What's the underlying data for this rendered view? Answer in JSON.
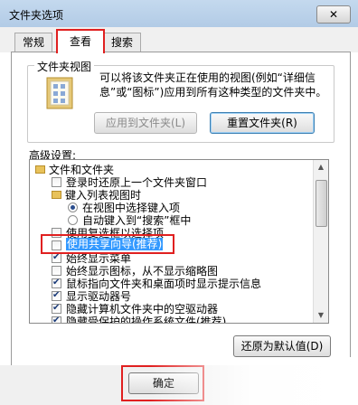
{
  "window": {
    "title": "文件夹选项",
    "close_label": "✕"
  },
  "tabs": [
    {
      "label": "常规"
    },
    {
      "label": "查看"
    },
    {
      "label": "搜索"
    }
  ],
  "folder_views": {
    "group_title": "文件夹视图",
    "description": "可以将该文件夹正在使用的视图(例如“详细信息”或“图标”)应用到所有这种类型的文件夹中。",
    "apply_button": "应用到文件夹(L)",
    "reset_button": "重置文件夹(R)"
  },
  "advanced": {
    "label": "高级设置:",
    "items": [
      {
        "text": "文件和文件夹",
        "kind": "folder"
      },
      {
        "text": "登录时还原上一个文件夹窗口",
        "kind": "checkbox",
        "checked": false
      },
      {
        "text": "键入列表视图时",
        "kind": "folder"
      },
      {
        "text": "在视图中选择键入项",
        "kind": "radio",
        "checked": true
      },
      {
        "text": "自动键入到“搜索”框中",
        "kind": "radio",
        "checked": false
      },
      {
        "text": "使用复选框以选择项",
        "kind": "checkbox",
        "checked": false
      },
      {
        "text": "使用共享向导(推荐)",
        "kind": "checkbox",
        "checked": false,
        "highlighted": true
      },
      {
        "text": "始终显示菜单",
        "kind": "checkbox",
        "checked": true
      },
      {
        "text": "始终显示图标，从不显示缩略图",
        "kind": "checkbox",
        "checked": false
      },
      {
        "text": "鼠标指向文件夹和桌面项时显示提示信息",
        "kind": "checkbox",
        "checked": true
      },
      {
        "text": "显示驱动器号",
        "kind": "checkbox",
        "checked": true
      },
      {
        "text": "隐藏计算机文件夹中的空驱动器",
        "kind": "checkbox",
        "checked": true
      },
      {
        "text": "隐藏受保护的操作系统文件(推荐)",
        "kind": "checkbox",
        "checked": true
      }
    ],
    "restore_button": "还原为默认值(D)"
  },
  "footer": {
    "ok_button": "确定"
  }
}
